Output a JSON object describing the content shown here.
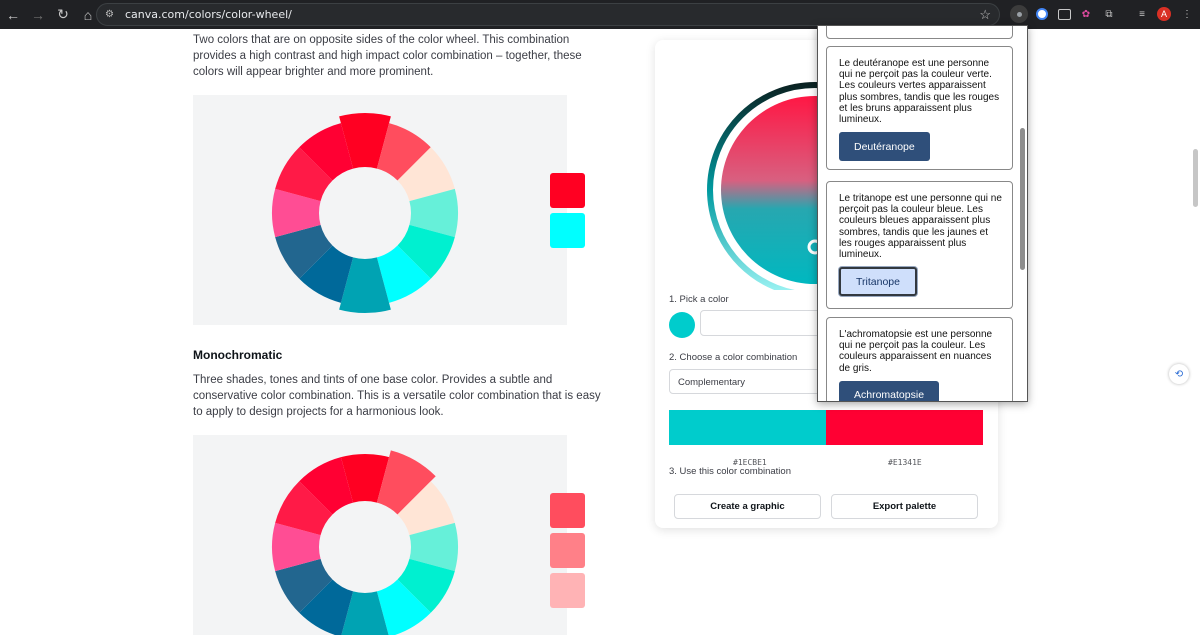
{
  "browser": {
    "url": "canva.com/colors/color-wheel/",
    "back_glyph": "←",
    "forward_glyph": "→",
    "reload_glyph": "↻",
    "home_glyph": "⌂",
    "site_glyph": "⚙",
    "star_glyph": "☆",
    "avatar_letter": "A"
  },
  "content": {
    "complementary_text": "Two colors that are on opposite sides of the color wheel. This combination provides a high contrast and high impact color combination – together, these colors will appear brighter and more prominent.",
    "monochromatic_heading": "Monochromatic",
    "monochromatic_text": "Three shades, tones and tints of one base color. Provides a subtle and conservative color combination. This is a versatile color combination that is easy to apply to design projects for a harmonious look."
  },
  "tool": {
    "pick_label": "1. Pick a color",
    "choose_label": "2. Choose a color combination",
    "combination_value": "Complementary",
    "use_label": "3. Use this color combination",
    "hex_left": "#1ECBE1",
    "hex_right": "#E1341E",
    "create_button": "Create a graphic",
    "export_button": "Export palette",
    "color_left": "#00cccc",
    "color_right": "#ff0033"
  },
  "popup": {
    "deuteranope_text": "Le deutéranope est une personne qui ne perçoit pas la couleur verte. Les couleurs vertes apparaissent plus sombres, tandis que les rouges et les bruns apparaissent plus lumineux.",
    "deuteranope_button": "Deutéranope",
    "tritanope_text": "Le tritanope est une personne qui ne perçoit pas la couleur bleue. Les couleurs bleues apparaissent plus sombres, tandis que les jaunes et les rouges apparaissent plus lumineux.",
    "tritanope_button": "Tritanope",
    "achromatopsie_text": "L'achromatopsie est une personne qui ne perçoit pas la couleur. Les couleurs apparaissent en nuances de gris.",
    "achromatopsie_button": "Achromatopsie"
  },
  "swatches": {
    "complementary": [
      "#ff0022",
      "#00ffff"
    ],
    "monochromatic": [
      "#ff4d5e",
      "#ff8088",
      "#ffb3b5"
    ]
  },
  "wheel_colors": [
    "#ff0022",
    "#ff4d5e",
    "#ffe5d6",
    "#66f0d9",
    "#00f0d0",
    "#00ffff",
    "#00a3b3",
    "#00699a",
    "#22668f",
    "#ff4d94",
    "#ff1a47",
    "#ff0033"
  ]
}
